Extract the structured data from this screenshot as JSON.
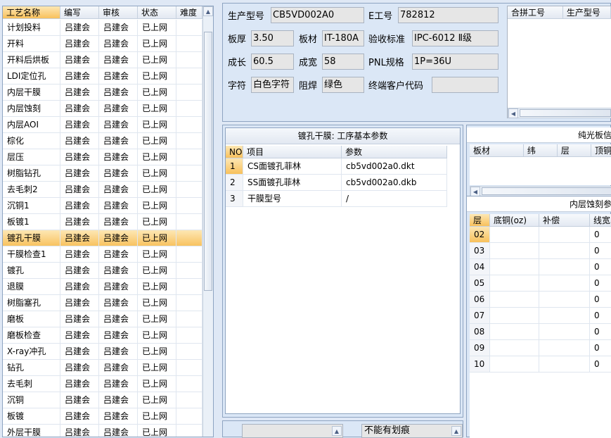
{
  "process_list": {
    "columns": [
      "工艺名称",
      "编写",
      "审核",
      "状态",
      "难度"
    ],
    "rows": [
      [
        "计划投料",
        "吕建会",
        "吕建会",
        "已上网",
        ""
      ],
      [
        "开料",
        "吕建会",
        "吕建会",
        "已上网",
        ""
      ],
      [
        "开料后烘板",
        "吕建会",
        "吕建会",
        "已上网",
        ""
      ],
      [
        "LDI定位孔",
        "吕建会",
        "吕建会",
        "已上网",
        ""
      ],
      [
        "内层干膜",
        "吕建会",
        "吕建会",
        "已上网",
        ""
      ],
      [
        "内层蚀刻",
        "吕建会",
        "吕建会",
        "已上网",
        ""
      ],
      [
        "内层AOI",
        "吕建会",
        "吕建会",
        "已上网",
        ""
      ],
      [
        "棕化",
        "吕建会",
        "吕建会",
        "已上网",
        ""
      ],
      [
        "层压",
        "吕建会",
        "吕建会",
        "已上网",
        ""
      ],
      [
        "树脂钻孔",
        "吕建会",
        "吕建会",
        "已上网",
        ""
      ],
      [
        "去毛刺2",
        "吕建会",
        "吕建会",
        "已上网",
        ""
      ],
      [
        "沉铜1",
        "吕建会",
        "吕建会",
        "已上网",
        ""
      ],
      [
        "板镀1",
        "吕建会",
        "吕建会",
        "已上网",
        ""
      ],
      [
        "镀孔干膜",
        "吕建会",
        "吕建会",
        "已上网",
        ""
      ],
      [
        "干膜检查1",
        "吕建会",
        "吕建会",
        "已上网",
        ""
      ],
      [
        "镀孔",
        "吕建会",
        "吕建会",
        "已上网",
        ""
      ],
      [
        "退膜",
        "吕建会",
        "吕建会",
        "已上网",
        ""
      ],
      [
        "树脂塞孔",
        "吕建会",
        "吕建会",
        "已上网",
        ""
      ],
      [
        "磨板",
        "吕建会",
        "吕建会",
        "已上网",
        ""
      ],
      [
        "磨板检查",
        "吕建会",
        "吕建会",
        "已上网",
        ""
      ],
      [
        "X-ray冲孔",
        "吕建会",
        "吕建会",
        "已上网",
        ""
      ],
      [
        "钻孔",
        "吕建会",
        "吕建会",
        "已上网",
        ""
      ],
      [
        "去毛刺",
        "吕建会",
        "吕建会",
        "已上网",
        ""
      ],
      [
        "沉铜",
        "吕建会",
        "吕建会",
        "已上网",
        ""
      ],
      [
        "板镀",
        "吕建会",
        "吕建会",
        "已上网",
        ""
      ],
      [
        "外层干膜",
        "吕建会",
        "吕建会",
        "已上网",
        ""
      ]
    ],
    "selected_index": 13
  },
  "info": {
    "model_label": "生产型号",
    "model_value": "CB5VD002A0",
    "eno_label": "E工号",
    "eno_value": "782812",
    "thickness_label": "板厚",
    "thickness_value": "3.50",
    "material_label": "板材",
    "material_value": "IT-180A",
    "standard_label": "验收标准",
    "standard_value": "IPC-6012 Ⅱ级",
    "length_label": "成长",
    "length_value": "60.5",
    "width_label": "成宽",
    "width_value": "58",
    "pnl_label": "PNL规格",
    "pnl_value": "1P=36U",
    "char_label": "字符",
    "char_value": "白色字符",
    "mask_label": "阻焊",
    "mask_value": "绿色",
    "customer_label": "终端客户代码",
    "customer_value": ""
  },
  "merge_table": {
    "columns": [
      "合拼工号",
      "生产型号"
    ]
  },
  "param_panel": {
    "title": "镀孔干膜: 工序基本参数",
    "columns": [
      "NO",
      "项目",
      "参数"
    ],
    "rows": [
      [
        "1",
        "CS面镀孔菲林",
        "cb5vd002a0.dkt"
      ],
      [
        "2",
        "SS面镀孔菲林",
        "cb5vd002a0.dkb"
      ],
      [
        "3",
        "干膜型号",
        "/"
      ]
    ]
  },
  "bare_panel": {
    "title": "纯光板信",
    "columns": [
      "板材",
      "纬",
      "层",
      "顶铜"
    ]
  },
  "etch_panel": {
    "title": "内层蚀刻参",
    "columns": [
      "层",
      "底铜(oz)",
      "补偿",
      "线宽"
    ],
    "rows": [
      [
        "02",
        "",
        "",
        "0"
      ],
      [
        "03",
        "",
        "",
        "0"
      ],
      [
        "04",
        "",
        "",
        "0"
      ],
      [
        "05",
        "",
        "",
        "0"
      ],
      [
        "06",
        "",
        "",
        "0"
      ],
      [
        "07",
        "",
        "",
        "0"
      ],
      [
        "08",
        "",
        "",
        "0"
      ],
      [
        "09",
        "",
        "",
        "0"
      ],
      [
        "10",
        "",
        "",
        "0"
      ]
    ]
  },
  "bottom": {
    "note_value": "不能有划痕"
  }
}
